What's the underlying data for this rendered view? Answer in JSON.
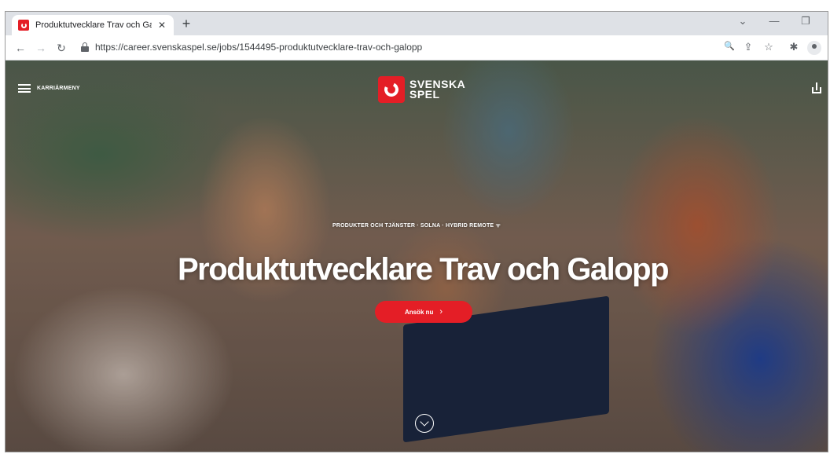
{
  "browser": {
    "tab": {
      "title": "Produktutvecklare Trav och Galop",
      "close_glyph": "✕"
    },
    "new_tab_glyph": "+",
    "window_controls": {
      "dropdown": "⌄",
      "minimize": "—",
      "restore": "❐"
    },
    "toolbar": {
      "back": "←",
      "forward": "→",
      "reload": "↻",
      "url": "https://career.svenskaspel.se/jobs/1544495-produktutvecklare-trav-och-galopp",
      "zoom_glyph": "🔍",
      "share_glyph": "⇪",
      "star_glyph": "☆",
      "extensions_glyph": "✱"
    }
  },
  "page": {
    "menu_label": "KARRIÄRMENY",
    "logo_line1": "SVENSKA",
    "logo_line2": "SPEL",
    "meta_line": "PRODUKTER OCH TJÄNSTER · SOLNA · HYBRID REMOTE",
    "wifi_glyph": "ᯤ",
    "headline": "Produktutvecklare Trav och Galopp",
    "apply_label": "Ansök nu",
    "apply_arrow": "›"
  },
  "colors": {
    "brand_red": "#e41e26",
    "chrome_bg": "#dee1e6"
  },
  "icons": [
    "hamburger-icon",
    "share-icon",
    "chevron-down-icon",
    "lock-icon",
    "svenska-spel-logo"
  ]
}
